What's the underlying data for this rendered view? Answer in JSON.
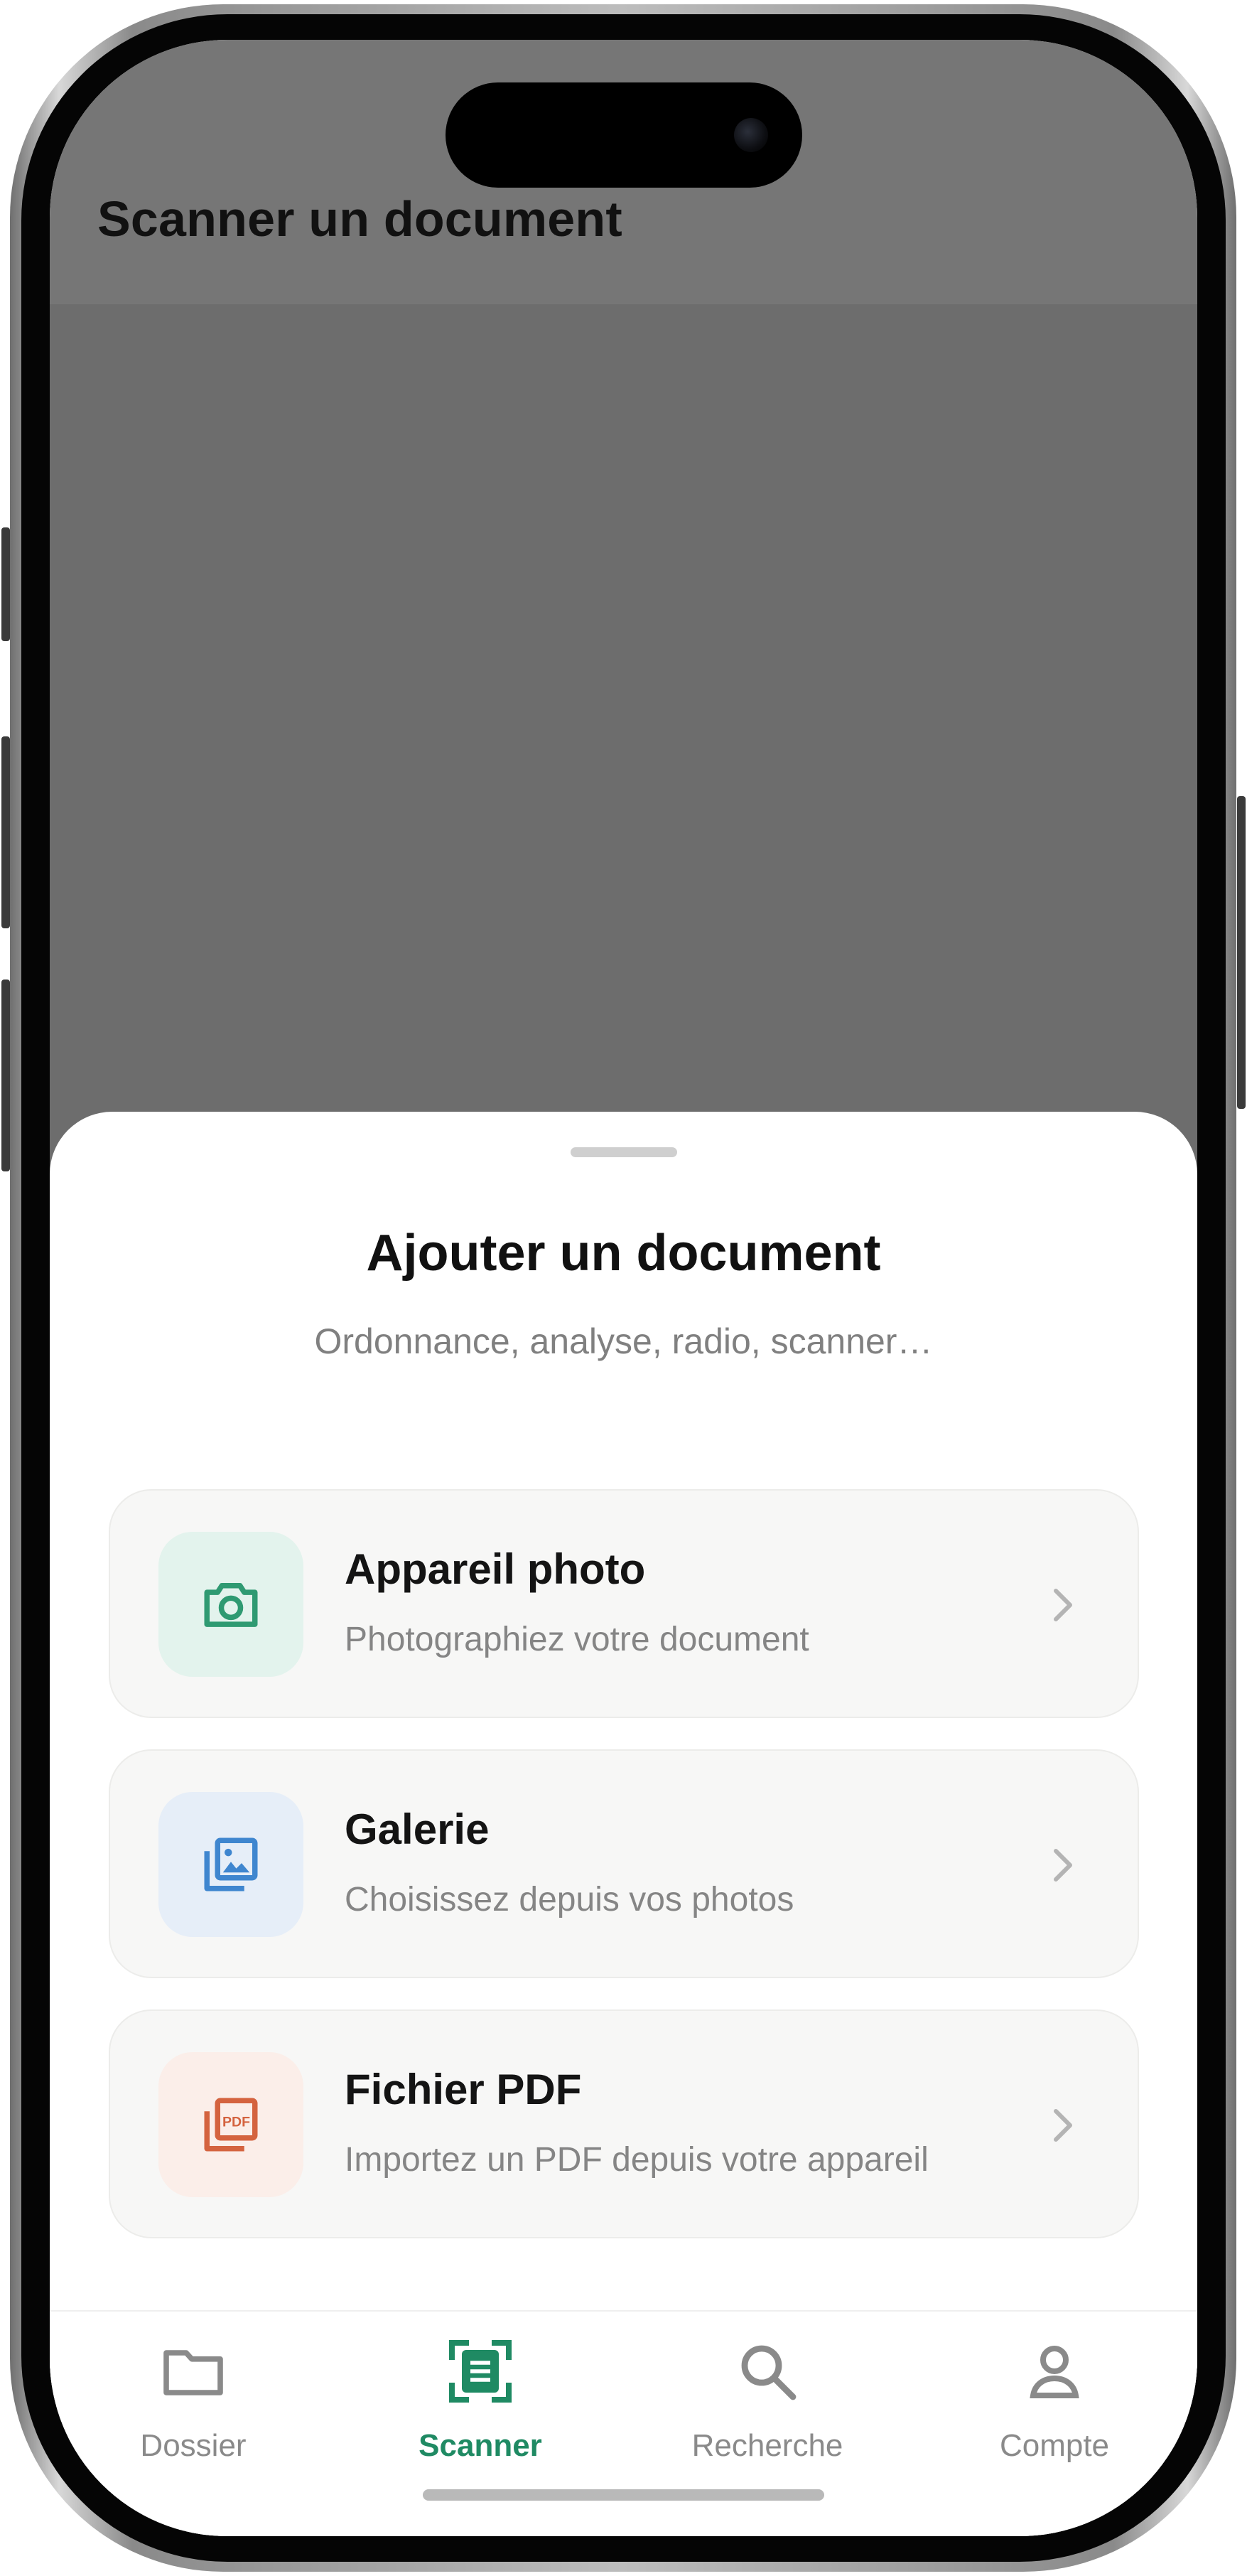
{
  "header": {
    "title": "Scanner un document"
  },
  "sheet": {
    "title": "Ajouter un document",
    "subtitle": "Ordonnance, analyse, radio, scanner…",
    "options": [
      {
        "title": "Appareil photo",
        "description": "Photographiez votre document",
        "icon": "camera-icon",
        "tint": "#e3f3ed",
        "color": "#2f9a72"
      },
      {
        "title": "Galerie",
        "description": "Choisissez depuis vos photos",
        "icon": "gallery-icon",
        "tint": "#e6eef8",
        "color": "#3f86cf"
      },
      {
        "title": "Fichier PDF",
        "description": "Importez un PDF depuis votre appareil",
        "icon": "pdf-file-icon",
        "tint": "#fbeee9",
        "color": "#d4633f"
      }
    ]
  },
  "tabbar": {
    "active": "Scanner",
    "accent": "#1f8a63",
    "tabs": [
      {
        "label": "Dossier",
        "icon": "folder-icon"
      },
      {
        "label": "Scanner",
        "icon": "scanner-icon"
      },
      {
        "label": "Recherche",
        "icon": "search-icon"
      },
      {
        "label": "Compte",
        "icon": "user-icon"
      }
    ]
  }
}
